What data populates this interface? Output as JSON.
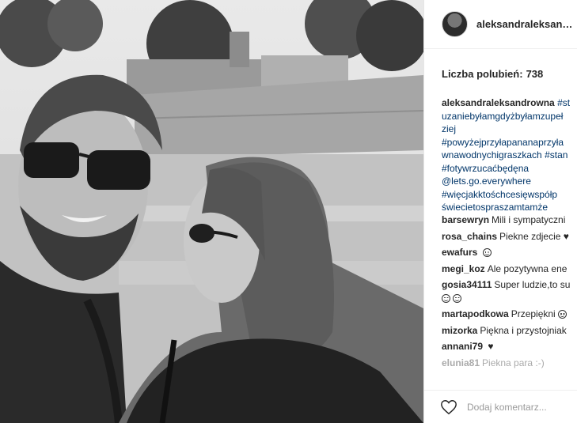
{
  "post": {
    "username": "aleksandraleksan…",
    "likes_label": "Liczba polubień:",
    "likes_count": "738",
    "caption": {
      "username": "aleksandraleksandrowna",
      "lines": [
        "#st",
        "uzaniebyłamgdyżbyłamzupeł",
        "ziej",
        "#powyżejprzyłapananaprzyła",
        "wnawodnychigraszkach #stan",
        "#fotywrzucaćbędęna",
        "@lets.go.everywhere",
        "#więcjakktośchcesięwspółp",
        "świecietospraszamtamże"
      ]
    },
    "comments": [
      {
        "user": "barsewryn",
        "text": "Mili i sympatyczni"
      },
      {
        "user": "rosa_chains",
        "text": "Piekne zdjecie",
        "icon": "heart-icon"
      },
      {
        "user": "ewafurs",
        "text": "",
        "icon": "smiley-icon"
      },
      {
        "user": "megi_koz",
        "text": "Ale pozytywna ene"
      },
      {
        "user": "gosia34111",
        "text": "Super ludzie,to su",
        "extra_icons": [
          "smiley-icon",
          "smiley-icon"
        ]
      },
      {
        "user": "martapodkowa",
        "text": "Przepiękni",
        "icon": "smiley-icon"
      },
      {
        "user": "mizorka",
        "text": "Piękna i przystojniak"
      },
      {
        "user": "annani79",
        "text": "",
        "icon": "heart-icon"
      },
      {
        "user": "elunia81",
        "text": "Piekna para :-)"
      }
    ],
    "comment_placeholder": "Dodaj komentarz..."
  }
}
